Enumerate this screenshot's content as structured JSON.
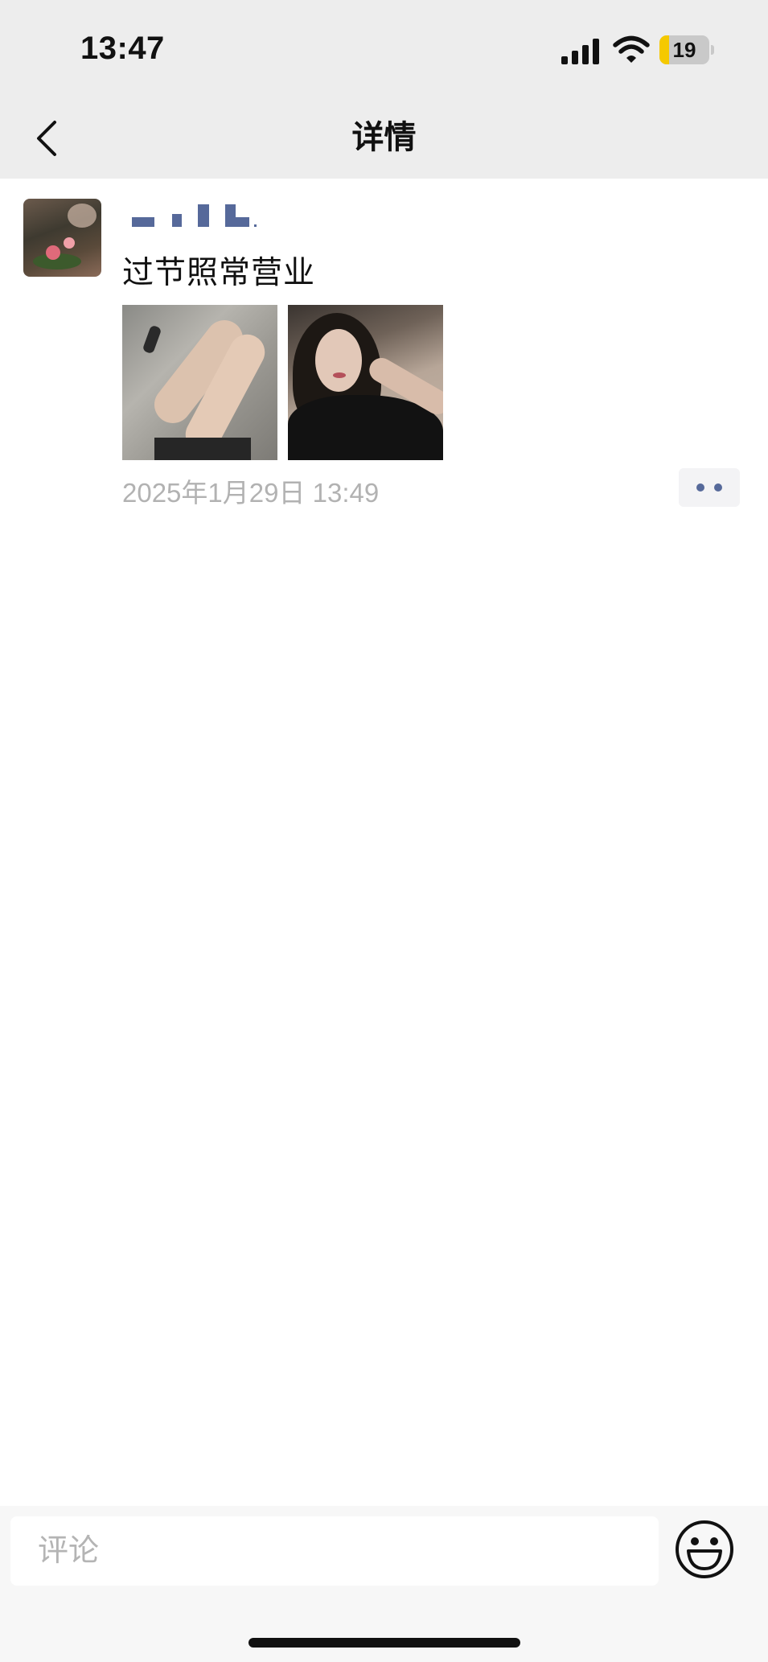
{
  "status_bar": {
    "time": "13:47",
    "battery_level": "19",
    "battery_fraction": 0.19,
    "icons": [
      "signal-icon",
      "wifi-icon",
      "battery-icon"
    ]
  },
  "nav": {
    "title": "详情",
    "back_icon": "chevron-left-icon"
  },
  "post": {
    "text": "过节照常营业",
    "photos": [
      "photo-1",
      "photo-2"
    ],
    "timestamp": "2025年1月29日 13:49",
    "more_icon": "more-dots-icon",
    "nickname_color": "#56699a"
  },
  "comment_bar": {
    "placeholder": "评论",
    "emoji_icon": "smiley-icon"
  },
  "colors": {
    "header_bg": "#ededed",
    "accent": "#56699a",
    "muted_text": "#b2b2b2",
    "battery": "#f5c900"
  }
}
